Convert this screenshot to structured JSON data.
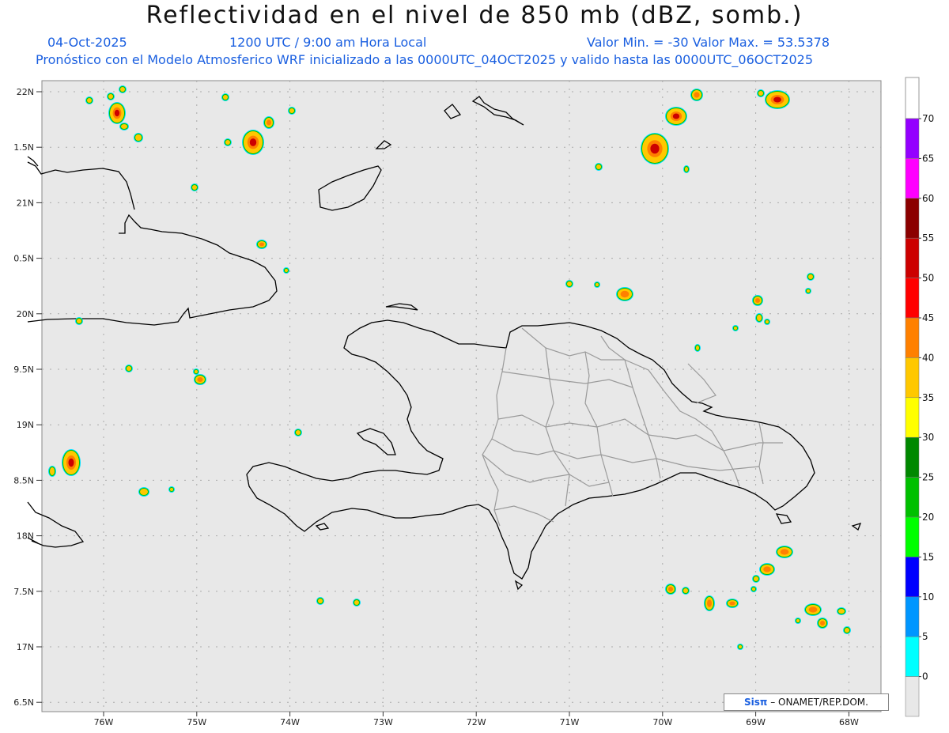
{
  "title": "Reflectividad en el nivel de 850 mb (dBZ, somb.)",
  "date": "04-Oct-2025",
  "time": "1200 UTC / 9:00 am Hora Local",
  "minmax": "Valor Min. = -30  Valor Max. = 53.5378",
  "forecast": "Pronóstico con el Modelo Atmosferico WRF inicializado a las 0000UTC_04OCT2025 y valido hasta las  0000UTC_06OCT2025",
  "credit": {
    "logo": "Sisπ",
    "text": " – ONAMET/REP.DOM."
  },
  "lat_labels": [
    "22N",
    "1.5N",
    "21N",
    "0.5N",
    "20N",
    "9.5N",
    "19N",
    "8.5N",
    "18N",
    "7.5N",
    "17N",
    "6.5N"
  ],
  "lon_labels": [
    "76W",
    "75W",
    "74W",
    "73W",
    "72W",
    "71W",
    "70W",
    "69W",
    "68W"
  ],
  "colorbar": {
    "labels": [
      "70",
      "65",
      "60",
      "55",
      "50",
      "45",
      "40",
      "35",
      "30",
      "25",
      "20",
      "15",
      "10",
      "5",
      "0"
    ],
    "colors": [
      "#9400ff",
      "#ff00ff",
      "#8b0000",
      "#cc0000",
      "#ff0000",
      "#ff8000",
      "#ffc800",
      "#ffff00",
      "#008800",
      "#00c000",
      "#00ff00",
      "#0000ff",
      "#0096ff",
      "#00ffff",
      "#e8e8e8"
    ]
  },
  "colors": {
    "background": "#e8e8e8",
    "coast": "#000000",
    "borders": "#9a9a9a",
    "accent": "#1a5fe0"
  }
}
